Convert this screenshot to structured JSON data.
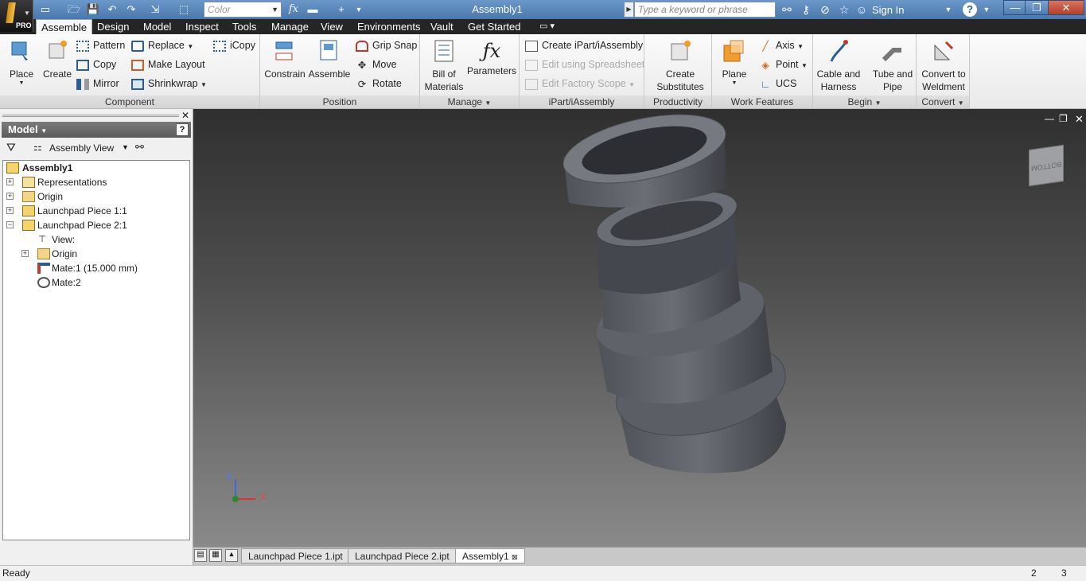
{
  "app": {
    "badge": "PRO",
    "window_title": "Assembly1"
  },
  "qat": {
    "color_combo": "Color",
    "fx": "fx"
  },
  "search": {
    "placeholder": "Type a keyword or phrase"
  },
  "account": {
    "sign_in": "Sign In"
  },
  "tabs": [
    "Assemble",
    "Design",
    "Model",
    "Inspect",
    "Tools",
    "Manage",
    "View",
    "Environments",
    "Vault",
    "Get Started"
  ],
  "ribbon": {
    "component": {
      "title": "Component",
      "place": "Place",
      "create": "Create",
      "pattern": "Pattern",
      "copy": "Copy",
      "mirror": "Mirror",
      "replace": "Replace",
      "make_layout": "Make Layout",
      "shrinkwrap": "Shrinkwrap",
      "icopy": "iCopy"
    },
    "position": {
      "title": "Position",
      "constrain": "Constrain",
      "assemble": "Assemble",
      "grip_snap": "Grip Snap",
      "move": "Move",
      "rotate": "Rotate"
    },
    "manage": {
      "title": "Manage",
      "bill_of_materials_1": "Bill of",
      "bill_of_materials_2": "Materials",
      "parameters": "Parameters"
    },
    "ipart": {
      "title": "iPart/iAssembly",
      "create": "Create iPart/iAssembly",
      "edit_spreadsheet": "Edit using Spreadsheet",
      "edit_factory": "Edit Factory Scope"
    },
    "productivity": {
      "title": "Productivity",
      "create_substitutes_1": "Create",
      "create_substitutes_2": "Substitutes"
    },
    "work_features": {
      "title": "Work Features",
      "plane": "Plane",
      "axis": "Axis",
      "point": "Point",
      "ucs": "UCS"
    },
    "begin": {
      "title": "Begin",
      "cable_1": "Cable and",
      "cable_2": "Harness",
      "tube_1": "Tube and",
      "tube_2": "Pipe"
    },
    "convert": {
      "title": "Convert",
      "weld_1": "Convert to",
      "weld_2": "Weldment"
    }
  },
  "browser": {
    "title": "Model",
    "view_select": "Assembly View",
    "tree": [
      {
        "label": "Assembly1"
      },
      {
        "label": "Representations"
      },
      {
        "label": "Origin"
      },
      {
        "label": "Launchpad Piece 1:1"
      },
      {
        "label": "Launchpad Piece 2:1"
      },
      {
        "label": "View:"
      },
      {
        "label": "Origin"
      },
      {
        "label": "Mate:1 (15.000 mm)"
      },
      {
        "label": "Mate:2"
      }
    ]
  },
  "viewcube": {
    "face": "BOTTOM"
  },
  "triad": {
    "x": "X",
    "z": "Z"
  },
  "doc_tabs": [
    "Launchpad Piece 1.ipt",
    "Launchpad Piece 2.ipt",
    "Assembly1"
  ],
  "status": {
    "text": "Ready",
    "count_a": "2",
    "count_b": "3"
  }
}
